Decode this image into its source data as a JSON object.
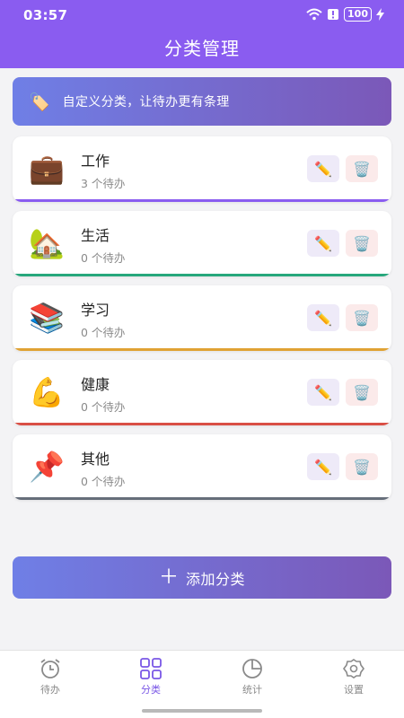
{
  "status": {
    "time": "03:57",
    "battery": "100"
  },
  "header": {
    "title": "分类管理"
  },
  "banner": {
    "icon": "tag-icon",
    "text": "自定义分类，让待办更有条理"
  },
  "categories": [
    {
      "emoji": "💼",
      "name": "工作",
      "count": "3 个待办",
      "color": "#8a5cf0"
    },
    {
      "emoji": "🏡",
      "name": "生活",
      "count": "0 个待办",
      "color": "#27a77c"
    },
    {
      "emoji": "📚",
      "name": "学习",
      "count": "0 个待办",
      "color": "#e0a233"
    },
    {
      "emoji": "💪",
      "name": "健康",
      "count": "0 个待办",
      "color": "#d94f45"
    },
    {
      "emoji": "📌",
      "name": "其他",
      "count": "0 个待办",
      "color": "#666e7a"
    }
  ],
  "actions": {
    "edit": "✏️",
    "delete": "🗑️"
  },
  "add_button": {
    "label": "添加分类"
  },
  "tabbar": {
    "todo": "待办",
    "category": "分类",
    "stats": "统计",
    "settings": "设置"
  }
}
